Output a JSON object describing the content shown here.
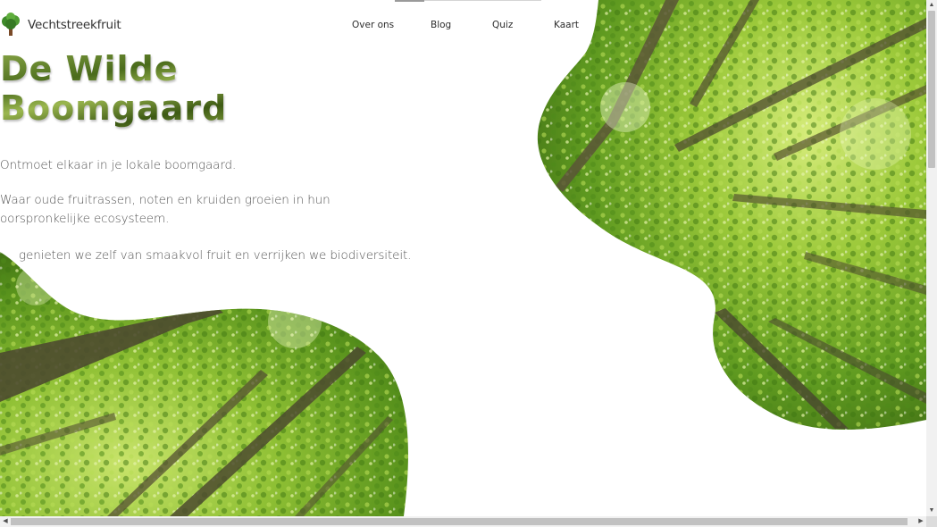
{
  "brand": {
    "name": "Vechtstreekfruit",
    "icon": "tree-logo-icon"
  },
  "nav": {
    "items": [
      {
        "label": "Over ons"
      },
      {
        "label": "Blog"
      },
      {
        "label": "Quiz"
      },
      {
        "label": "Kaart"
      }
    ]
  },
  "hero": {
    "title_line1": "De Wilde",
    "title_line2": "Boomgaard",
    "paragraph1": "Ontmoet elkaar in je lokale boomgaard.",
    "paragraph2": "Waar oude fruitrassen, noten en kruiden groeien in hun oorspronkelijke ecosysteem.",
    "paragraph3": "genieten we zelf van smaakvol fruit en verrijken we biodiversiteit."
  },
  "images": {
    "top_right": "forest-canopy-image",
    "bottom_left": "forest-canopy-image"
  },
  "colors": {
    "title_green": "#5a7a22",
    "text": "#555555",
    "foliage_light": "#a6cf3c",
    "foliage_dark": "#3f6a12"
  }
}
